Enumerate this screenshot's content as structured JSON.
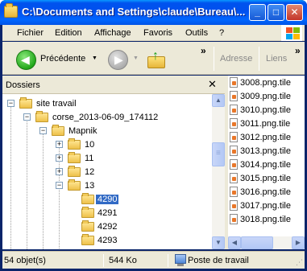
{
  "window": {
    "title": "C:\\Documents and Settings\\claude\\Bureau\\..."
  },
  "titlebar_buttons": {
    "minimize": "_",
    "maximize": "□",
    "close": "✕"
  },
  "menu": {
    "items": [
      "Fichier",
      "Edition",
      "Affichage",
      "Favoris",
      "Outils",
      "?"
    ]
  },
  "toolbar": {
    "back_label": "Précédente",
    "chevron": "»",
    "address_label": "Adresse",
    "links_label": "Liens"
  },
  "folders_pane": {
    "title": "Dossiers",
    "close": "✕"
  },
  "tree": {
    "site_travail": "site travail",
    "corse": "corse_2013-06-09_174112",
    "mapnik": "Mapnik",
    "z10": "10",
    "z11": "11",
    "z12": "12",
    "z13": "13",
    "items": [
      "4290",
      "4291",
      "4292",
      "4293"
    ],
    "selected": "4290"
  },
  "files": [
    "3008.png.tile",
    "3009.png.tile",
    "3010.png.tile",
    "3011.png.tile",
    "3012.png.tile",
    "3013.png.tile",
    "3014.png.tile",
    "3015.png.tile",
    "3016.png.tile",
    "3017.png.tile",
    "3018.png.tile"
  ],
  "status": {
    "objects": "54 objet(s)",
    "size": "544 Ko",
    "location": "Poste de travail"
  }
}
